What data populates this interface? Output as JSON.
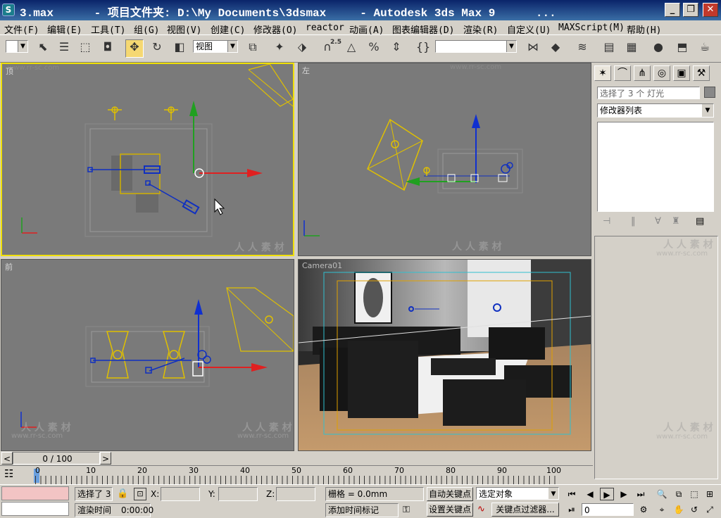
{
  "window": {
    "icon_glyph": "S",
    "title": "3.max      - 项目文件夹: D:\\My Documents\\3dsmax     - Autodesk 3ds Max 9      ...",
    "minimize": "_",
    "maximize": "❐",
    "close": "✕"
  },
  "menu": [
    "文件(F)",
    "编辑(E)",
    "工具(T)",
    "组(G)",
    "视图(V)",
    "创建(C)",
    "修改器(O)",
    "reactor",
    "动画(A)",
    "图表编辑器(D)",
    "渲染(R)",
    "自定义(U)",
    "MAXScript(M)",
    "帮助(H)"
  ],
  "toolbar": {
    "selection_filter": "",
    "ref_coord": "视图",
    "snap_angle_label": "2.5",
    "named_selection": ""
  },
  "viewports": {
    "top": {
      "label": "顶"
    },
    "left": {
      "label": "左"
    },
    "front": {
      "label": "前"
    },
    "camera": {
      "label": "Camera01"
    }
  },
  "watermark": {
    "cn": "人 人 素 材",
    "url": "www.rr-sc.com"
  },
  "command_panel": {
    "selection_field": "选择了 3 个 灯光",
    "modifier_list": "修改器列表"
  },
  "timeline": {
    "frame_display": "0 / 100",
    "prev": "<",
    "next": ">",
    "ticks": [
      "0",
      "10",
      "20",
      "30",
      "40",
      "50",
      "60",
      "70",
      "80",
      "90",
      "100"
    ]
  },
  "status": {
    "selected": "选择了 3",
    "x_label": "X:",
    "y_label": "Y:",
    "z_label": "Z:",
    "x_value": "",
    "y_value": "",
    "z_value": "",
    "grid": "栅格 = 0.0mm",
    "render_time_label": "渲染时间",
    "render_time": "0:00:00",
    "add_time_tag": "添加时间标记",
    "auto_key": "自动关键点",
    "set_key": "设置关键点",
    "selected_object": "选定对象",
    "key_filters": "关键点过滤器...",
    "frame": "0"
  },
  "colors": {
    "titlebar": "#0a246a",
    "viewport_bg": "#7a7a7a",
    "active_border": "#f0e000",
    "selected_light": "#f0d000",
    "camera_light": "#1030c0",
    "axis_x": "#e02020",
    "axis_y": "#20a020",
    "axis_z": "#1030d0"
  }
}
